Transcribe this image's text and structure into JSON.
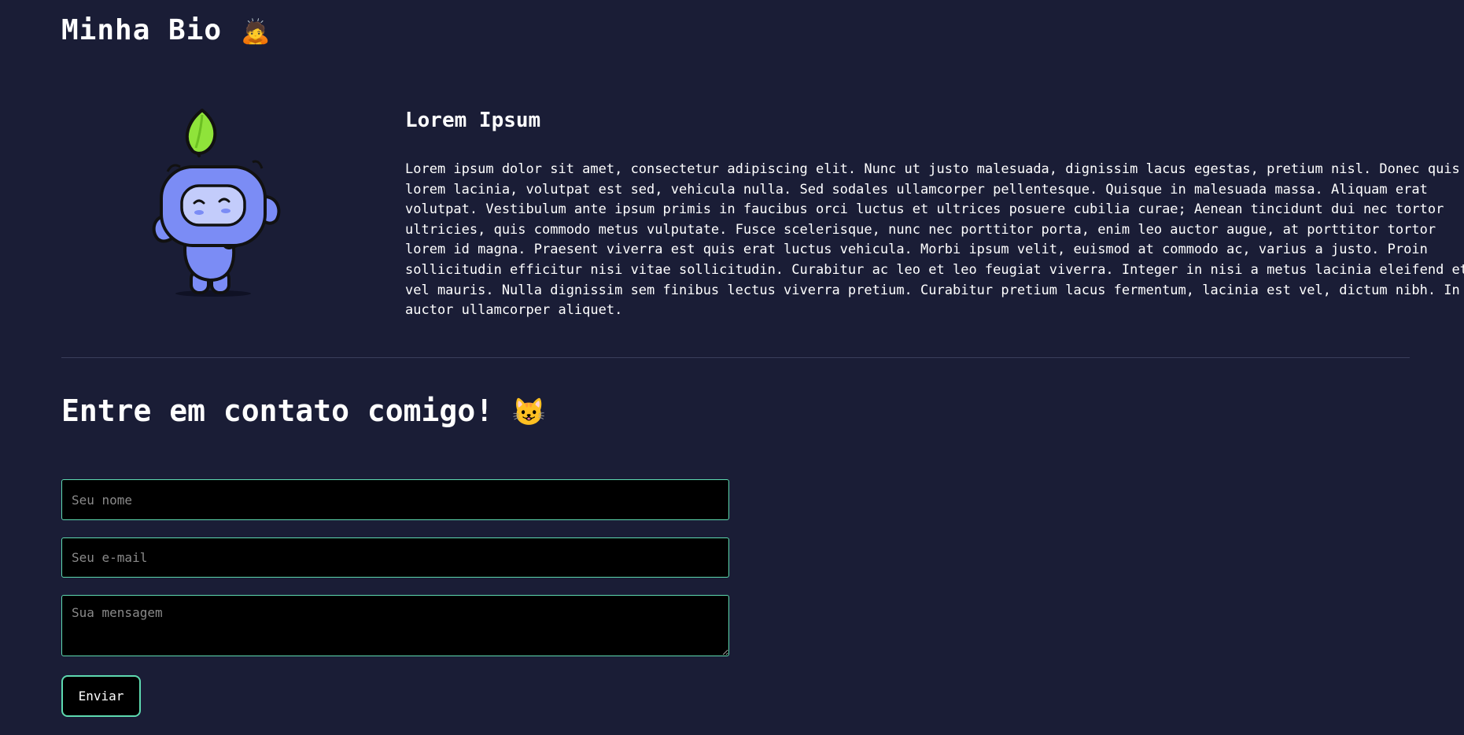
{
  "header": {
    "title": "Minha Bio",
    "emoji": "🙇"
  },
  "bio": {
    "image_icon": "wumpus-mascot",
    "heading": "Lorem Ipsum",
    "text": "Lorem ipsum dolor sit amet, consectetur adipiscing elit. Nunc ut justo malesuada, dignissim lacus egestas, pretium nisl. Donec quis lorem lacinia, volutpat est sed, vehicula nulla. Sed sodales ullamcorper pellentesque. Quisque in malesuada massa. Aliquam erat volutpat. Vestibulum ante ipsum primis in faucibus orci luctus et ultrices posuere cubilia curae; Aenean tincidunt dui nec tortor ultricies, quis commodo metus vulputate. Fusce scelerisque, nunc nec porttitor porta, enim leo auctor augue, at porttitor tortor lorem id magna. Praesent viverra est quis erat luctus vehicula. Morbi ipsum velit, euismod at commodo ac, varius a justo. Proin sollicitudin efficitur nisi vitae sollicitudin. Curabitur ac leo et leo feugiat viverra. Integer in nisi a metus lacinia eleifend et vel mauris. Nulla dignissim sem finibus lectus viverra pretium. Curabitur pretium lacus fermentum, lacinia est vel, dictum nibh. In auctor ullamcorper aliquet."
  },
  "contact": {
    "title": "Entre em contato comigo!",
    "emoji": "😺",
    "name_placeholder": "Seu nome",
    "email_placeholder": "Seu e-mail",
    "message_placeholder": "Sua mensagem",
    "submit_label": "Enviar"
  },
  "colors": {
    "background": "#1a1d36",
    "accent": "#5ed9b0",
    "mascot_body": "#7b8cf5",
    "leaf": "#8fe33a"
  }
}
